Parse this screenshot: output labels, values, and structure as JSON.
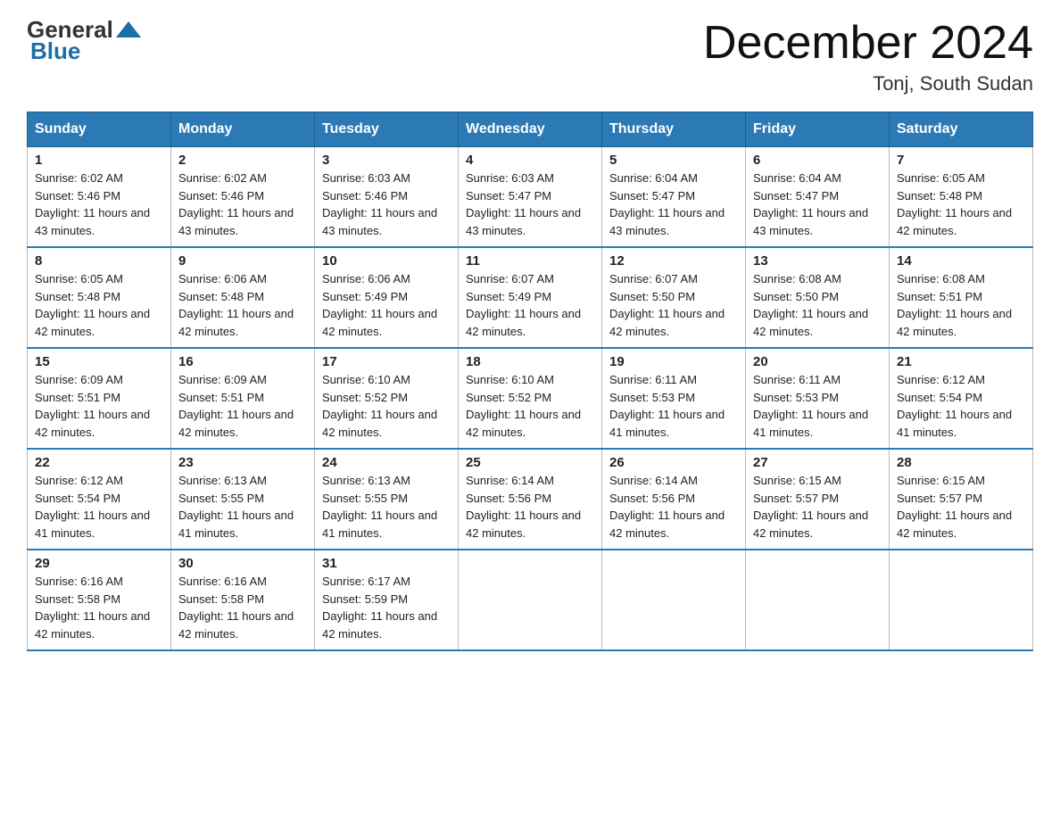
{
  "header": {
    "logo_general": "General",
    "logo_blue": "Blue",
    "month_title": "December 2024",
    "location": "Tonj, South Sudan"
  },
  "days_of_week": [
    "Sunday",
    "Monday",
    "Tuesday",
    "Wednesday",
    "Thursday",
    "Friday",
    "Saturday"
  ],
  "weeks": [
    [
      {
        "day": "1",
        "sunrise": "6:02 AM",
        "sunset": "5:46 PM",
        "daylight": "11 hours and 43 minutes."
      },
      {
        "day": "2",
        "sunrise": "6:02 AM",
        "sunset": "5:46 PM",
        "daylight": "11 hours and 43 minutes."
      },
      {
        "day": "3",
        "sunrise": "6:03 AM",
        "sunset": "5:46 PM",
        "daylight": "11 hours and 43 minutes."
      },
      {
        "day": "4",
        "sunrise": "6:03 AM",
        "sunset": "5:47 PM",
        "daylight": "11 hours and 43 minutes."
      },
      {
        "day": "5",
        "sunrise": "6:04 AM",
        "sunset": "5:47 PM",
        "daylight": "11 hours and 43 minutes."
      },
      {
        "day": "6",
        "sunrise": "6:04 AM",
        "sunset": "5:47 PM",
        "daylight": "11 hours and 43 minutes."
      },
      {
        "day": "7",
        "sunrise": "6:05 AM",
        "sunset": "5:48 PM",
        "daylight": "11 hours and 42 minutes."
      }
    ],
    [
      {
        "day": "8",
        "sunrise": "6:05 AM",
        "sunset": "5:48 PM",
        "daylight": "11 hours and 42 minutes."
      },
      {
        "day": "9",
        "sunrise": "6:06 AM",
        "sunset": "5:48 PM",
        "daylight": "11 hours and 42 minutes."
      },
      {
        "day": "10",
        "sunrise": "6:06 AM",
        "sunset": "5:49 PM",
        "daylight": "11 hours and 42 minutes."
      },
      {
        "day": "11",
        "sunrise": "6:07 AM",
        "sunset": "5:49 PM",
        "daylight": "11 hours and 42 minutes."
      },
      {
        "day": "12",
        "sunrise": "6:07 AM",
        "sunset": "5:50 PM",
        "daylight": "11 hours and 42 minutes."
      },
      {
        "day": "13",
        "sunrise": "6:08 AM",
        "sunset": "5:50 PM",
        "daylight": "11 hours and 42 minutes."
      },
      {
        "day": "14",
        "sunrise": "6:08 AM",
        "sunset": "5:51 PM",
        "daylight": "11 hours and 42 minutes."
      }
    ],
    [
      {
        "day": "15",
        "sunrise": "6:09 AM",
        "sunset": "5:51 PM",
        "daylight": "11 hours and 42 minutes."
      },
      {
        "day": "16",
        "sunrise": "6:09 AM",
        "sunset": "5:51 PM",
        "daylight": "11 hours and 42 minutes."
      },
      {
        "day": "17",
        "sunrise": "6:10 AM",
        "sunset": "5:52 PM",
        "daylight": "11 hours and 42 minutes."
      },
      {
        "day": "18",
        "sunrise": "6:10 AM",
        "sunset": "5:52 PM",
        "daylight": "11 hours and 42 minutes."
      },
      {
        "day": "19",
        "sunrise": "6:11 AM",
        "sunset": "5:53 PM",
        "daylight": "11 hours and 41 minutes."
      },
      {
        "day": "20",
        "sunrise": "6:11 AM",
        "sunset": "5:53 PM",
        "daylight": "11 hours and 41 minutes."
      },
      {
        "day": "21",
        "sunrise": "6:12 AM",
        "sunset": "5:54 PM",
        "daylight": "11 hours and 41 minutes."
      }
    ],
    [
      {
        "day": "22",
        "sunrise": "6:12 AM",
        "sunset": "5:54 PM",
        "daylight": "11 hours and 41 minutes."
      },
      {
        "day": "23",
        "sunrise": "6:13 AM",
        "sunset": "5:55 PM",
        "daylight": "11 hours and 41 minutes."
      },
      {
        "day": "24",
        "sunrise": "6:13 AM",
        "sunset": "5:55 PM",
        "daylight": "11 hours and 41 minutes."
      },
      {
        "day": "25",
        "sunrise": "6:14 AM",
        "sunset": "5:56 PM",
        "daylight": "11 hours and 42 minutes."
      },
      {
        "day": "26",
        "sunrise": "6:14 AM",
        "sunset": "5:56 PM",
        "daylight": "11 hours and 42 minutes."
      },
      {
        "day": "27",
        "sunrise": "6:15 AM",
        "sunset": "5:57 PM",
        "daylight": "11 hours and 42 minutes."
      },
      {
        "day": "28",
        "sunrise": "6:15 AM",
        "sunset": "5:57 PM",
        "daylight": "11 hours and 42 minutes."
      }
    ],
    [
      {
        "day": "29",
        "sunrise": "6:16 AM",
        "sunset": "5:58 PM",
        "daylight": "11 hours and 42 minutes."
      },
      {
        "day": "30",
        "sunrise": "6:16 AM",
        "sunset": "5:58 PM",
        "daylight": "11 hours and 42 minutes."
      },
      {
        "day": "31",
        "sunrise": "6:17 AM",
        "sunset": "5:59 PM",
        "daylight": "11 hours and 42 minutes."
      },
      null,
      null,
      null,
      null
    ]
  ]
}
